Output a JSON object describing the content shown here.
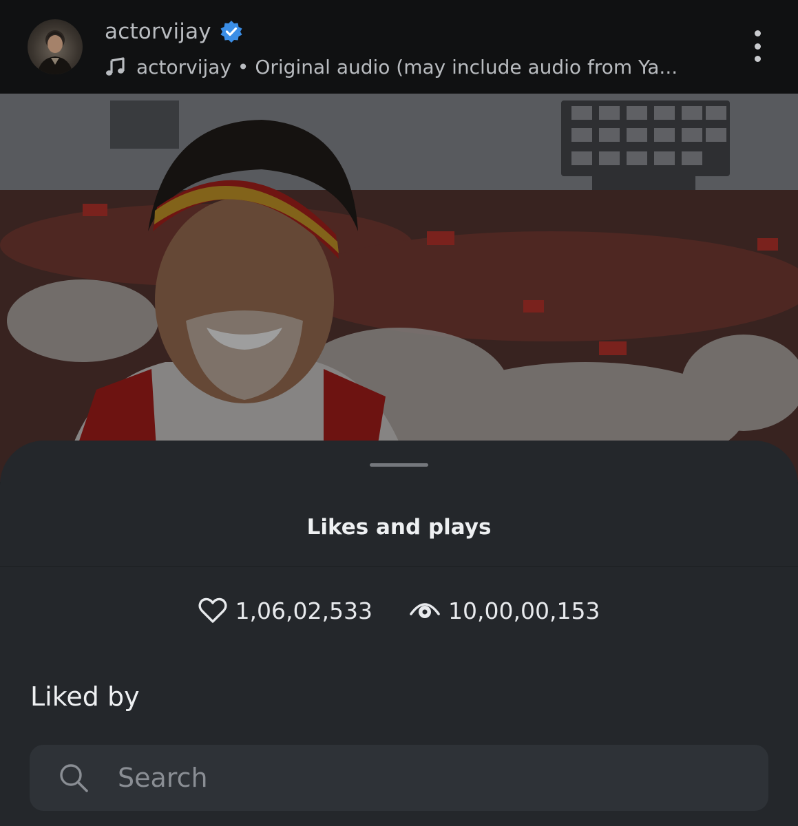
{
  "header": {
    "username": "actorvijay",
    "audio": "actorvijay • Original audio (may include audio from Ya...",
    "icons": {
      "verified": "verified-badge-icon",
      "music": "music-note-icon",
      "more": "more-vertical-icon"
    },
    "colors": {
      "verified": "#3b8ee6",
      "background": "#101112"
    }
  },
  "sheet": {
    "title": "Likes and plays",
    "likes": "1,06,02,533",
    "plays": "10,00,00,153",
    "liked_by_label": "Liked by",
    "search": {
      "placeholder": "Search"
    },
    "colors": {
      "background": "#24272b",
      "search_bg": "#2e3237"
    }
  }
}
